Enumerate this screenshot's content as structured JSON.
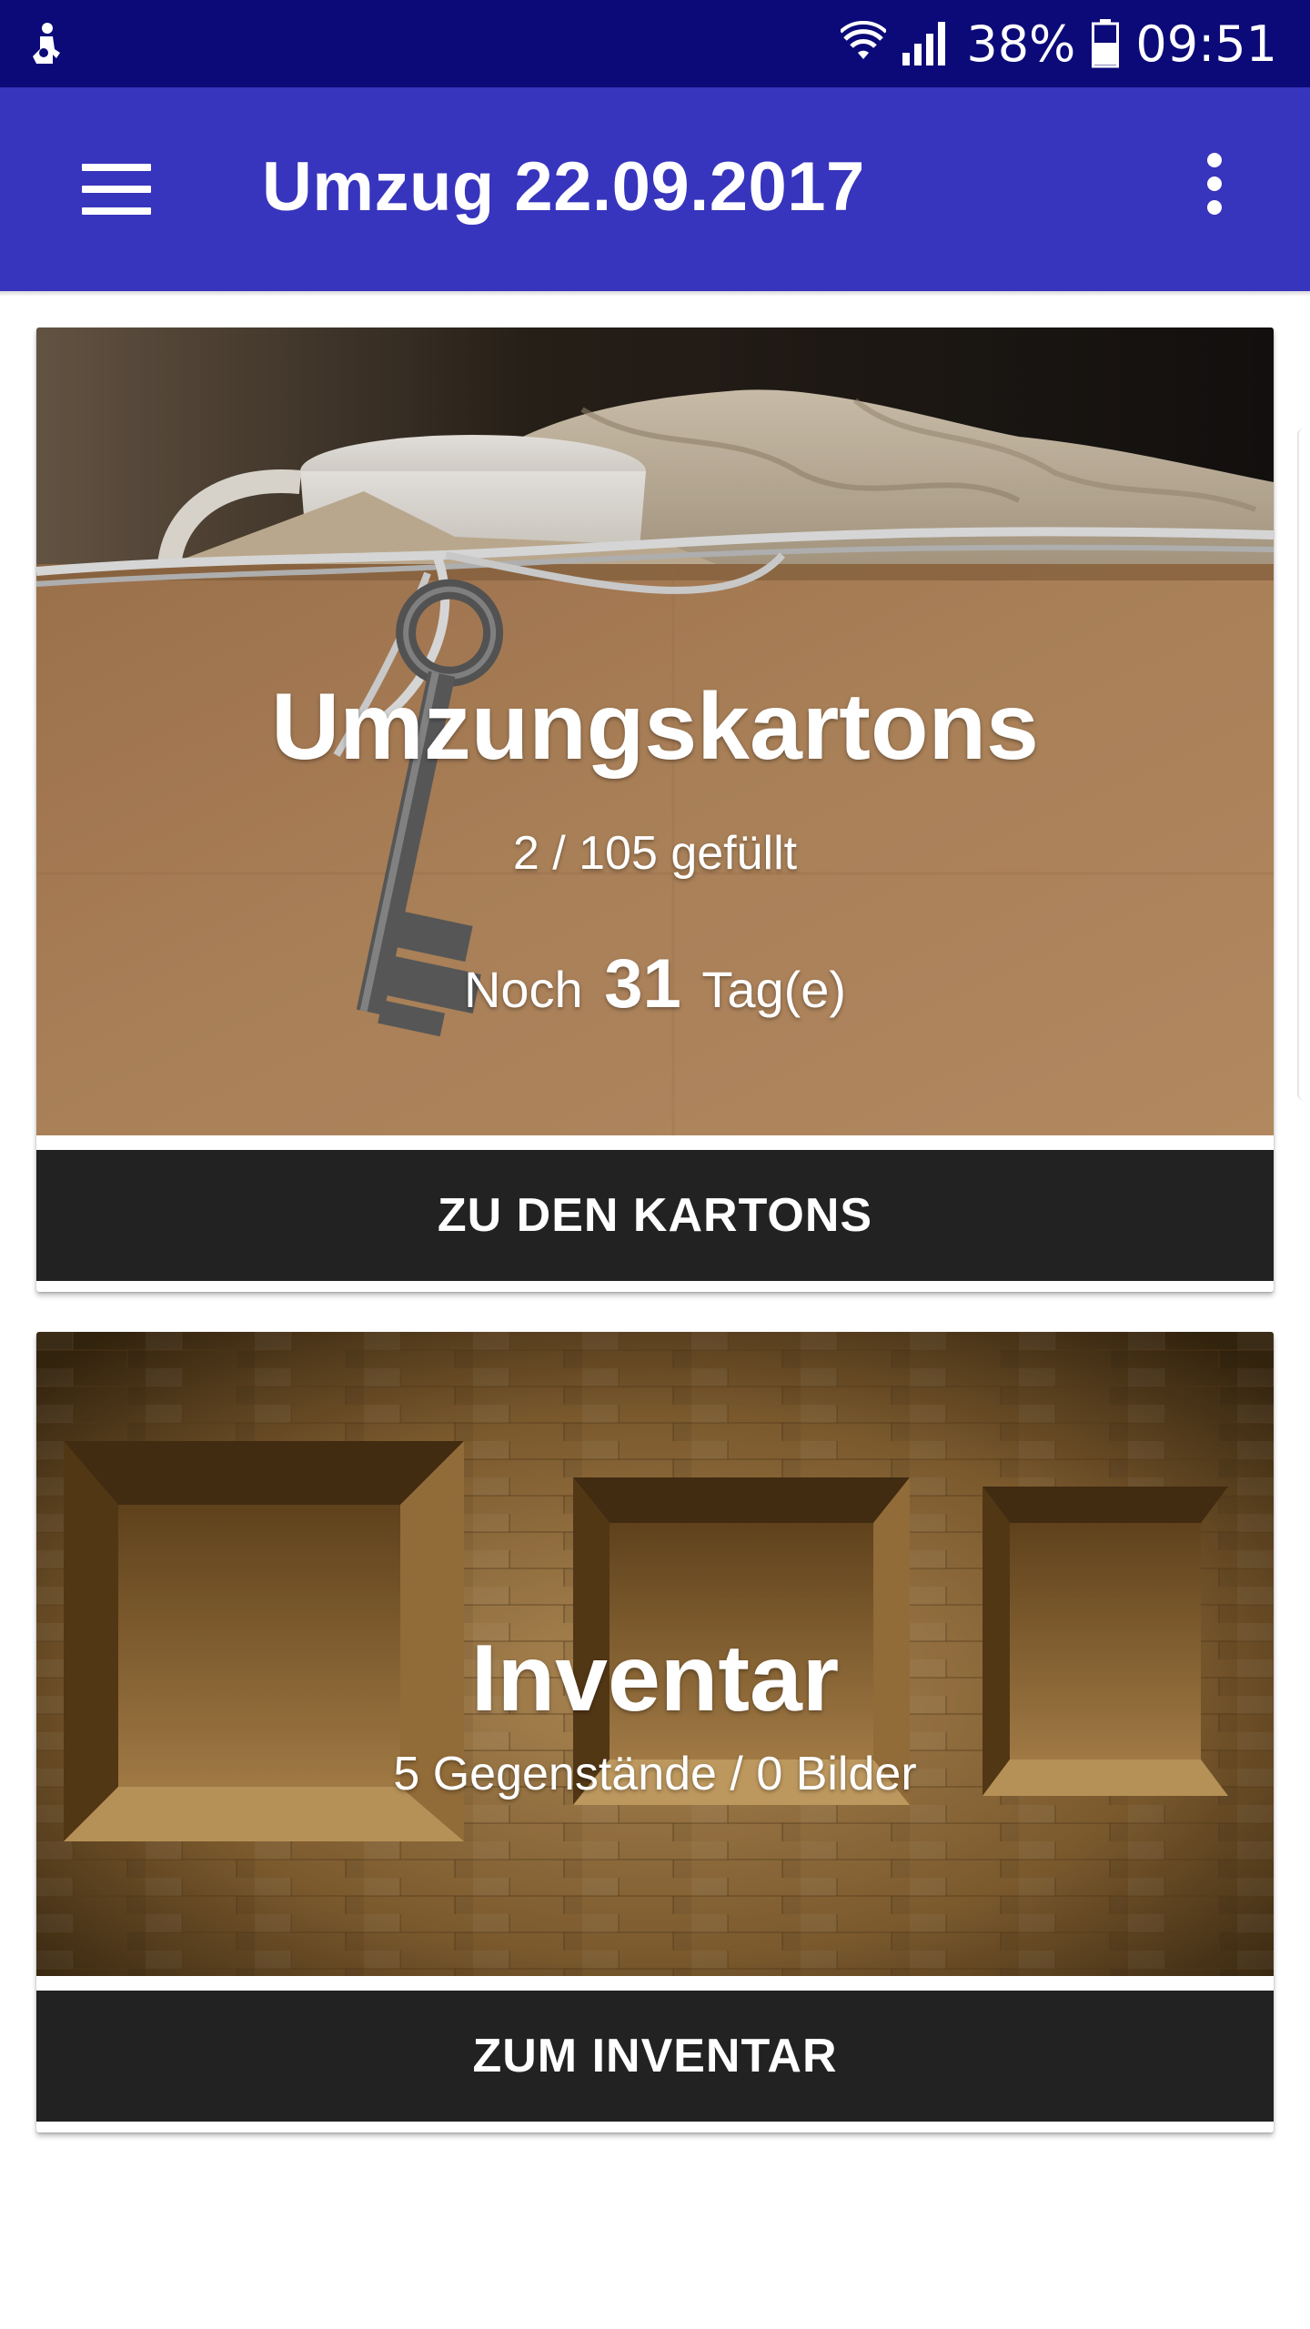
{
  "status_bar": {
    "battery": "38%",
    "time": "09:51"
  },
  "app_bar": {
    "title": "Umzug 22.09.2017",
    "menu_icon": "menu-icon",
    "more_icon": "more-vert-icon"
  },
  "boxes_card": {
    "title": "Umzungskartons",
    "filled": "2 / 105 gefüllt",
    "days_prefix": "Noch",
    "days_number": "31",
    "days_suffix": "Tag(e)",
    "button_label": "ZU DEN KARTONS"
  },
  "inventory_card": {
    "title": "Inventar",
    "subtitle": "5 Gegenstände / 0 Bilder",
    "button_label": "ZUM INVENTAR"
  },
  "colors": {
    "status_bar": "#0b0a78",
    "app_bar": "#3734bd",
    "button": "#222222"
  }
}
